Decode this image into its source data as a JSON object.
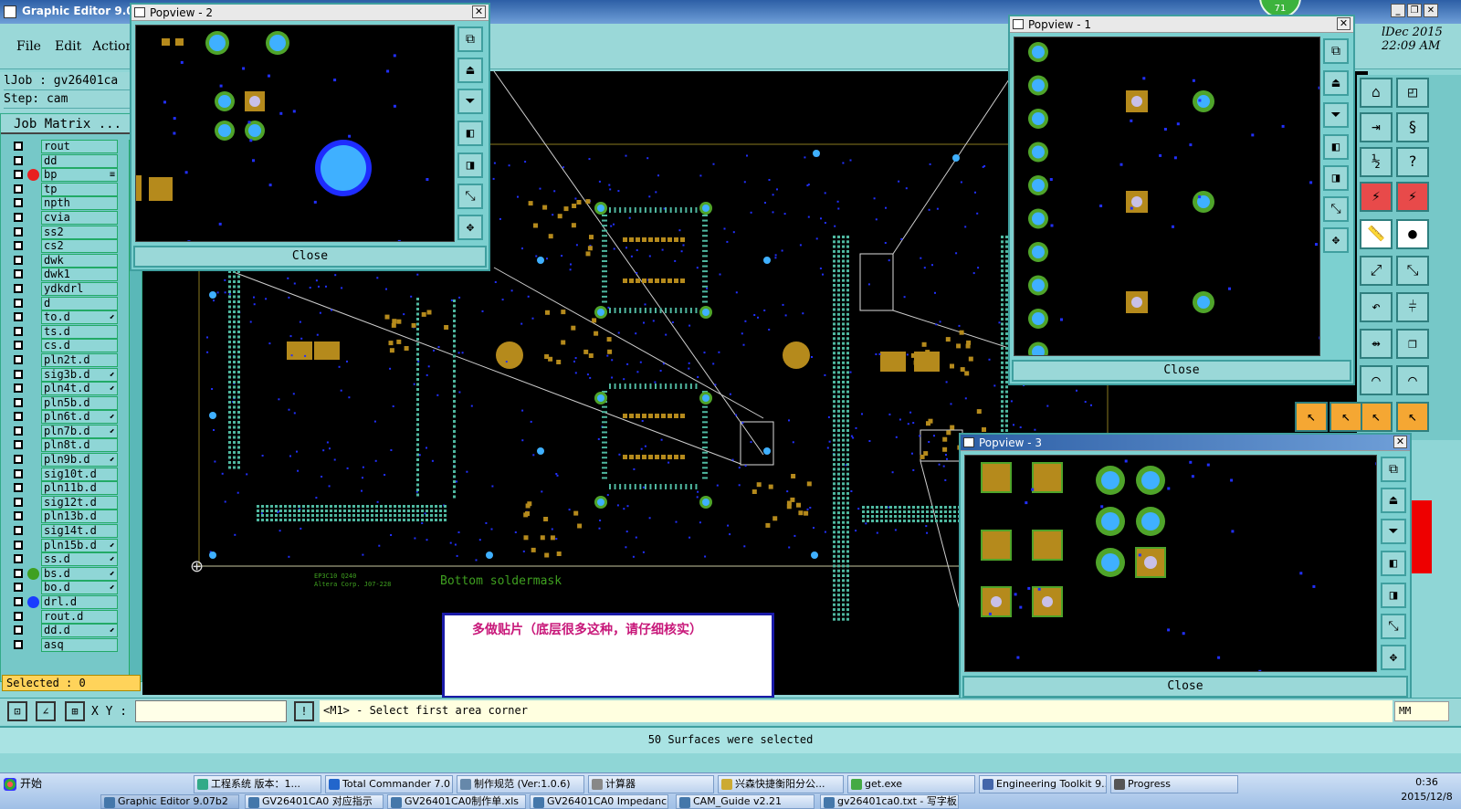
{
  "app": {
    "title": "Graphic Editor 9.07b2",
    "badge": "71",
    "date_line1": "lDec 2015",
    "date_line2": "22:09 AM",
    "minimize": "_",
    "restore": "❐",
    "close": "✕"
  },
  "menu": {
    "file": "File",
    "edit": "Edit",
    "action": "Action"
  },
  "job": {
    "job_line": "lJob : gv26401ca",
    "step_line": "Step: cam"
  },
  "matrix": {
    "title": "Job Matrix ...",
    "layers": [
      {
        "name": "rout",
        "dot": "",
        "mark": ""
      },
      {
        "name": "dd",
        "dot": "",
        "mark": ""
      },
      {
        "name": "bp",
        "dot": "#e82020",
        "mark": "≡"
      },
      {
        "name": "tp",
        "dot": "",
        "mark": ""
      },
      {
        "name": "npth",
        "dot": "",
        "mark": ""
      },
      {
        "name": "cvia",
        "dot": "",
        "mark": ""
      },
      {
        "name": "ss2",
        "dot": "",
        "mark": ""
      },
      {
        "name": "cs2",
        "dot": "",
        "mark": ""
      },
      {
        "name": "dwk",
        "dot": "",
        "mark": ""
      },
      {
        "name": "dwk1",
        "dot": "",
        "mark": ""
      },
      {
        "name": "ydkdrl",
        "dot": "",
        "mark": ""
      },
      {
        "name": "d",
        "dot": "",
        "mark": ""
      },
      {
        "name": "to.d",
        "dot": "",
        "mark": "⬋"
      },
      {
        "name": "ts.d",
        "dot": "",
        "mark": ""
      },
      {
        "name": "cs.d",
        "dot": "",
        "mark": ""
      },
      {
        "name": "pln2t.d",
        "dot": "",
        "mark": ""
      },
      {
        "name": "sig3b.d",
        "dot": "",
        "mark": "⬋"
      },
      {
        "name": "pln4t.d",
        "dot": "",
        "mark": "⬋"
      },
      {
        "name": "pln5b.d",
        "dot": "",
        "mark": ""
      },
      {
        "name": "pln6t.d",
        "dot": "",
        "mark": "⬋"
      },
      {
        "name": "pln7b.d",
        "dot": "",
        "mark": "⬋"
      },
      {
        "name": "pln8t.d",
        "dot": "",
        "mark": ""
      },
      {
        "name": "pln9b.d",
        "dot": "",
        "mark": "⬋"
      },
      {
        "name": "sig10t.d",
        "dot": "",
        "mark": ""
      },
      {
        "name": "pln11b.d",
        "dot": "",
        "mark": ""
      },
      {
        "name": "sig12t.d",
        "dot": "",
        "mark": ""
      },
      {
        "name": "pln13b.d",
        "dot": "",
        "mark": ""
      },
      {
        "name": "sig14t.d",
        "dot": "",
        "mark": ""
      },
      {
        "name": "pln15b.d",
        "dot": "",
        "mark": "⬋"
      },
      {
        "name": "ss.d",
        "dot": "",
        "mark": "⬋"
      },
      {
        "name": "bs.d",
        "dot": "#3fa020",
        "mark": "⬋"
      },
      {
        "name": "bo.d",
        "dot": "",
        "mark": "⬋"
      },
      {
        "name": "drl.d",
        "dot": "#1a3cff",
        "mark": ""
      },
      {
        "name": "rout.d",
        "dot": "",
        "mark": ""
      },
      {
        "name": "dd.d",
        "dot": "",
        "mark": "⬋"
      },
      {
        "name": "asq",
        "dot": "",
        "mark": ""
      }
    ],
    "selected": "Selected : 0"
  },
  "canvas": {
    "layer_label": "Bottom soldermask",
    "board_text_1": "EP3C10 Q240",
    "board_text_2": "Altera Corp. J07-228"
  },
  "popviews": [
    {
      "title": "Popview - 2",
      "close": "Close"
    },
    {
      "title": "Popview - 1",
      "close": "Close"
    },
    {
      "title": "Popview - 3",
      "close": "Close"
    }
  ],
  "note": "多做贴片（底层很多这种，请仔细核实）",
  "status": {
    "xy_label": "X Y :",
    "prompt": "<M1> - Select first area corner",
    "units": "MM",
    "message": "50 Surfaces were selected"
  },
  "taskbar": {
    "start": "开始",
    "tasks": [
      "工程系统  版本：1...",
      "Total Commander 7.0 ...",
      "制作规范 (Ver:1.0.6)",
      "计算器",
      "兴森快捷衡阳分公...",
      "get.exe",
      "Engineering Toolkit 9....",
      "Progress"
    ],
    "tasks_row2": [
      "Graphic Editor 9.07b2",
      "GV26401CA0 对应指示",
      "GV26401CA0制作单.xls",
      "GV26401CA0 Impedance",
      "CAM_Guide v2.21",
      "gv26401ca0.txt - 写字板"
    ],
    "clock_time": "0:36",
    "clock_date": "2015/12/8"
  },
  "colors": {
    "teal": "#8fd6d6",
    "copper": "#b58a1c",
    "pad_green": "#4fa42a",
    "pad_blue": "#3fb0ff",
    "via": "#1e2cff",
    "smd": "#c8c0e8"
  }
}
